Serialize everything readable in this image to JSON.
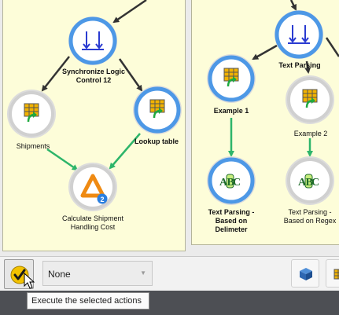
{
  "nodes": {
    "sync_left": {
      "label": "Synchronize Logic\nControl 12"
    },
    "shipments": {
      "label": "Shipments"
    },
    "lookup_table": {
      "label": "Lookup table"
    },
    "calc_shipping": {
      "label": "Calculate Shipment\nHandling Cost",
      "badge": "2"
    },
    "text_parsing": {
      "label": "Text Parsing"
    },
    "example1": {
      "label": "Example 1"
    },
    "example2": {
      "label": "Example 2"
    },
    "tp_delimeter": {
      "label": "Text Parsing -\nBased on\nDelimeter"
    },
    "tp_regex": {
      "label": "Text Parsing -\nBased on Regex"
    }
  },
  "toolbar": {
    "selection_value": "None",
    "tooltip": "Execute the selected actions"
  },
  "colors": {
    "panel_bg": "#fdfdd9",
    "node_active_ring": "#4d98e6",
    "node_inactive_ring": "#d0d0d0",
    "arrow_dark": "#333333",
    "arrow_green": "#2db56a",
    "accent_orange": "#ef8a12",
    "status_bar": "#4d4f54"
  }
}
